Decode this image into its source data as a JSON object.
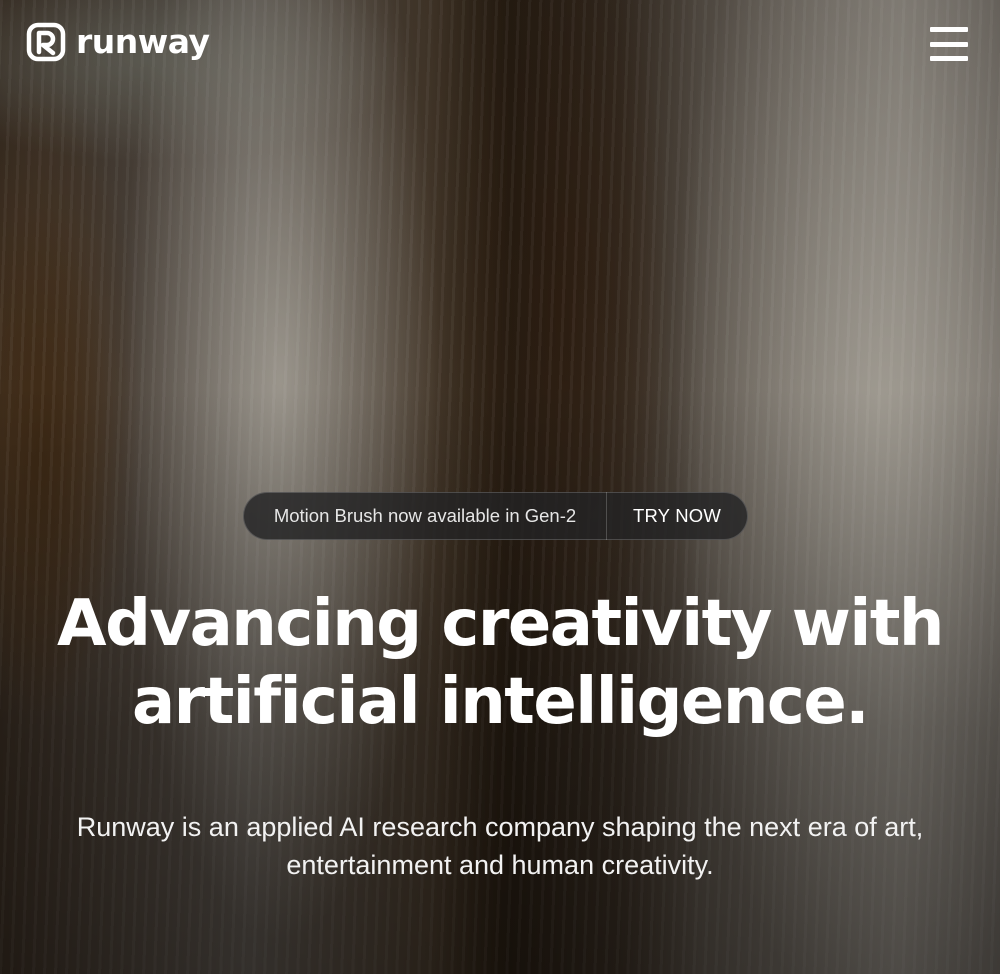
{
  "header": {
    "logo_text": "runway",
    "logo_icon": "runway-logo-icon",
    "menu_icon": "hamburger-menu-icon"
  },
  "announcement": {
    "text": "Motion Brush now available in Gen-2",
    "cta_label": "TRY NOW"
  },
  "hero": {
    "headline": "Advancing creativity with artificial intelligence.",
    "subtext": "Runway is an applied AI research company shaping the next era of art, entertainment and human creativity."
  },
  "colors": {
    "text": "#ffffff",
    "pill_background": "#232324"
  }
}
